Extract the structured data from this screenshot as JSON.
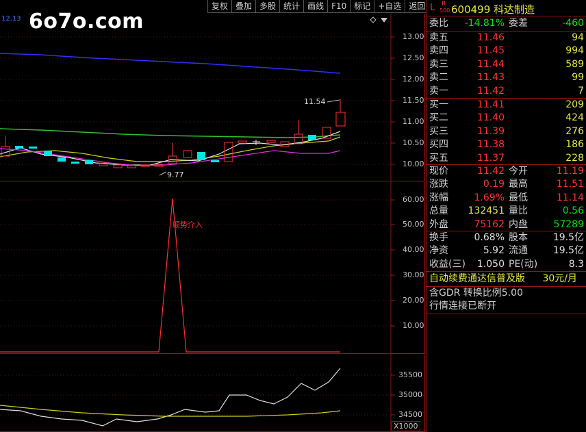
{
  "toolbar": [
    "复权",
    "叠加",
    "多股",
    "统计",
    "画线",
    "F10",
    "标记",
    "+自选",
    "返回"
  ],
  "watermark": "6o7o.com",
  "chart_date": "12.13",
  "price_axis": [
    "13.00",
    "12.50",
    "12.00",
    "11.50",
    "11.00",
    "10.50",
    "10.00"
  ],
  "high_marker": "11.54",
  "low_marker": "9.77",
  "indicator_axis": [
    "60.00",
    "50.00",
    "40.00",
    "30.00",
    "20.00",
    "10.00"
  ],
  "indicator_signal": "顺势介入",
  "volume_axis": [
    "35500",
    "35000",
    "34500"
  ],
  "volume_unit": "X1000",
  "stock": {
    "badge_l": "L",
    "badge_r": "R",
    "badge_500": "500",
    "code_name": "600499 科达制造"
  },
  "weibi": {
    "label1": "委比",
    "value1": "-14.81%",
    "label2": "委差",
    "value2": "-460"
  },
  "asks": [
    {
      "label": "卖五",
      "price": "11.46",
      "vol": "94"
    },
    {
      "label": "卖四",
      "price": "11.45",
      "vol": "994"
    },
    {
      "label": "卖三",
      "price": "11.44",
      "vol": "589"
    },
    {
      "label": "卖二",
      "price": "11.43",
      "vol": "99"
    },
    {
      "label": "卖一",
      "price": "11.42",
      "vol": "7"
    }
  ],
  "bids": [
    {
      "label": "买一",
      "price": "11.41",
      "vol": "209"
    },
    {
      "label": "买二",
      "price": "11.40",
      "vol": "424"
    },
    {
      "label": "买三",
      "price": "11.39",
      "vol": "276"
    },
    {
      "label": "买四",
      "price": "11.38",
      "vol": "186"
    },
    {
      "label": "买五",
      "price": "11.37",
      "vol": "228"
    }
  ],
  "stats": [
    {
      "l1": "现价",
      "v1": "11.42",
      "c1": "red",
      "l2": "今开",
      "v2": "11.19",
      "c2": "red"
    },
    {
      "l1": "涨跌",
      "v1": "0.19",
      "c1": "red",
      "l2": "最高",
      "v2": "11.51",
      "c2": "red"
    },
    {
      "l1": "涨幅",
      "v1": "1.69%",
      "c1": "red",
      "l2": "最低",
      "v2": "11.14",
      "c2": "red"
    },
    {
      "l1": "总量",
      "v1": "132451",
      "c1": "yellow",
      "l2": "量比",
      "v2": "0.56",
      "c2": "green"
    },
    {
      "l1": "外盘",
      "v1": "75162",
      "c1": "red",
      "l2": "内盘",
      "v2": "57289",
      "c2": "green"
    }
  ],
  "fundamentals": [
    {
      "l1": "换手",
      "v1": "0.68%",
      "l2": "股本",
      "v2": "19.5亿"
    },
    {
      "l1": "净资",
      "v1": "5.92",
      "l2": "流通",
      "v2": "19.5亿"
    },
    {
      "l1": "收益(三)",
      "v1": "1.050",
      "l2": "PE(动)",
      "v2": "8.3"
    }
  ],
  "promo": {
    "text": "自动续费通达信普及版",
    "price": "30元/月"
  },
  "gdr": "含GDR 转换比例5.00",
  "status": "行情连接已断开",
  "colors": {
    "up": "#ff3030",
    "down": "#00e6e6",
    "border": "#a01010",
    "ma_blue": "#3030ff",
    "ma_green": "#30d030"
  }
}
